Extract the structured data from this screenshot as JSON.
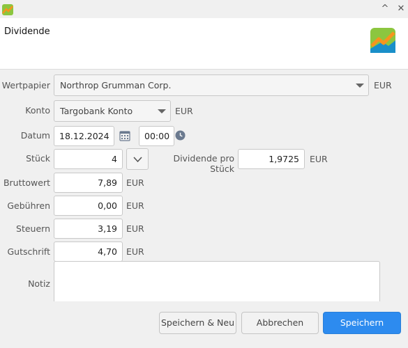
{
  "window": {
    "title": "Dividende",
    "app_icon": "app-chart-icon",
    "logo": "app-logo-icon"
  },
  "titlebar": {
    "collapse_icon": "chevron-up-icon",
    "close_icon": "close-icon",
    "collapse_glyph": "^",
    "close_glyph": "✕"
  },
  "form": {
    "security": {
      "label": "Wertpapier",
      "value": "Northrop Grumman Corp.",
      "currency": "EUR"
    },
    "account": {
      "label": "Konto",
      "value": "Targobank Konto",
      "currency": "EUR"
    },
    "date": {
      "label": "Datum",
      "value": "18.12.2024",
      "time": "00:00",
      "calendar_icon": "calendar-icon",
      "clock_icon": "clock-icon"
    },
    "shares": {
      "label": "Stück",
      "value": "4",
      "stepper_icon": "chevron-down-icon"
    },
    "dividend_per_share": {
      "label": "Dividende pro Stück",
      "value": "1,9725",
      "currency": "EUR"
    },
    "gross": {
      "label": "Bruttowert",
      "value": "7,89",
      "currency": "EUR"
    },
    "fees": {
      "label": "Gebühren",
      "value": "0,00",
      "currency": "EUR"
    },
    "taxes": {
      "label": "Steuern",
      "value": "3,19",
      "currency": "EUR"
    },
    "credit": {
      "label": "Gutschrift",
      "value": "4,70",
      "currency": "EUR"
    },
    "note": {
      "label": "Notiz",
      "value": ""
    }
  },
  "buttons": {
    "save_and_new": "Speichern & Neu",
    "cancel": "Abbrechen",
    "save": "Speichern"
  },
  "colors": {
    "primary": "#2d8bef",
    "logo_green": "#8cc63f",
    "logo_orange": "#f7941d",
    "logo_blue": "#1a8fc9"
  }
}
